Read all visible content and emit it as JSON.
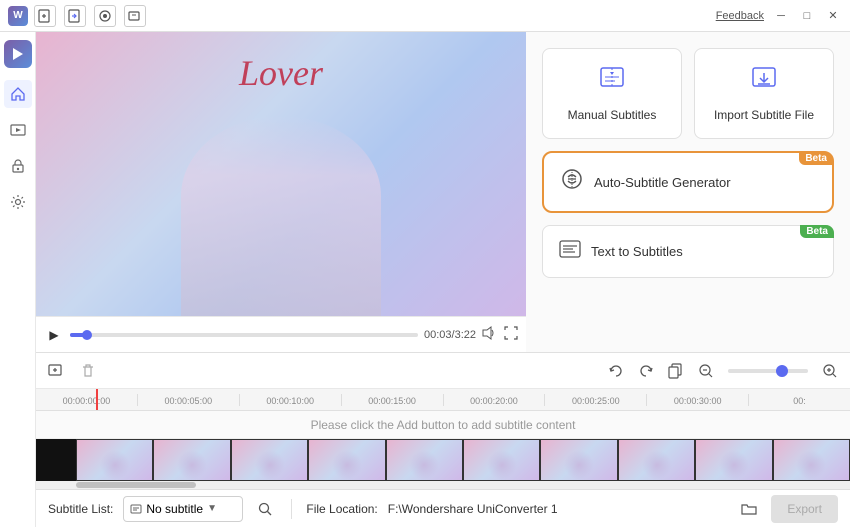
{
  "titleBar": {
    "feedback": "Feedback",
    "tools": [
      "new-project",
      "import",
      "record",
      "export"
    ]
  },
  "sidebar": {
    "items": [
      "home",
      "media",
      "lock",
      "settings"
    ]
  },
  "videoPlayer": {
    "title": "Lover",
    "time": "00:03/3:22",
    "timeDisplay": "00:03/3:22"
  },
  "rightPanel": {
    "manualSubtitles": {
      "label": "Manual Subtitles"
    },
    "importSubtitle": {
      "label": "Import Subtitle File"
    },
    "autoSubtitle": {
      "label": "Auto-Subtitle Generator",
      "badge": "Beta"
    },
    "textToSubtitles": {
      "label": "Text to Subtitles",
      "badge": "Beta"
    }
  },
  "timeline": {
    "rulerTicks": [
      "00:00:00:00",
      "00:00:05:00",
      "00:00:10:00",
      "00:00:15:00",
      "00:00:20:00",
      "00:00:25:00",
      "00:00:30:00",
      "00:"
    ],
    "placeholderText": "Please click the Add button to add subtitle content"
  },
  "bottomBar": {
    "subtitleListLabel": "Subtitle List:",
    "noSubtitle": "No subtitle",
    "fileLocationLabel": "File Location:",
    "filePath": "F:\\Wondershare UniConverter 1",
    "exportLabel": "Export"
  }
}
